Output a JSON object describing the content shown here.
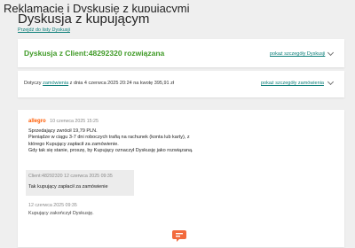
{
  "header": {
    "breadcrumb_title": "Reklamacje i Dyskusje z kupującymi",
    "page_title": "Dyskusja z kupującym",
    "back_link": "Przejdź do listy Dyskusji"
  },
  "status_card": {
    "title": "Dyskusja z Client:48292320 rozwiązana",
    "details_link": "pokaż szczegóły Dyskusji"
  },
  "order_card": {
    "prefix": "Dotyczy",
    "order_link": "zamówienia",
    "middle": "z dnia 4 czerwca 2025 20:24 na kwotę",
    "amount": "395,91 zł",
    "details_link": "pokaż szczegóły zamówienia"
  },
  "thread": {
    "seller_message": {
      "brand": "allegro",
      "timestamp": "10 czerwca 2025 15:25",
      "lines": [
        "Sprzedający zwrócił 19,79 PLN.",
        "Pieniądze w ciągu 3-7 dni roboczych trafią na rachunek (konta lub karty), z",
        "którego Kupujący zapłacił za zamówienie.",
        "Gdy tak się stanie, proszę, by Kupujący oznaczył Dyskusję jako rozwiązaną."
      ]
    },
    "client_message": {
      "meta": "Client:48292320 12 czerwca 2025 09:35",
      "text": "Tak kupujący zapłacił za zamówienie"
    },
    "closing": {
      "timestamp": "12 czerwca 2025 09:35",
      "text": "Kupujący zakończył Dyskusję."
    }
  },
  "icons": {
    "chat": "chat-bubble-icon",
    "chevron": "chevron-down-icon"
  },
  "colors": {
    "success": "#3f9a26",
    "link": "#0a7d78",
    "brand": "#ff5a00",
    "chat_icon": "#f26a3d"
  }
}
